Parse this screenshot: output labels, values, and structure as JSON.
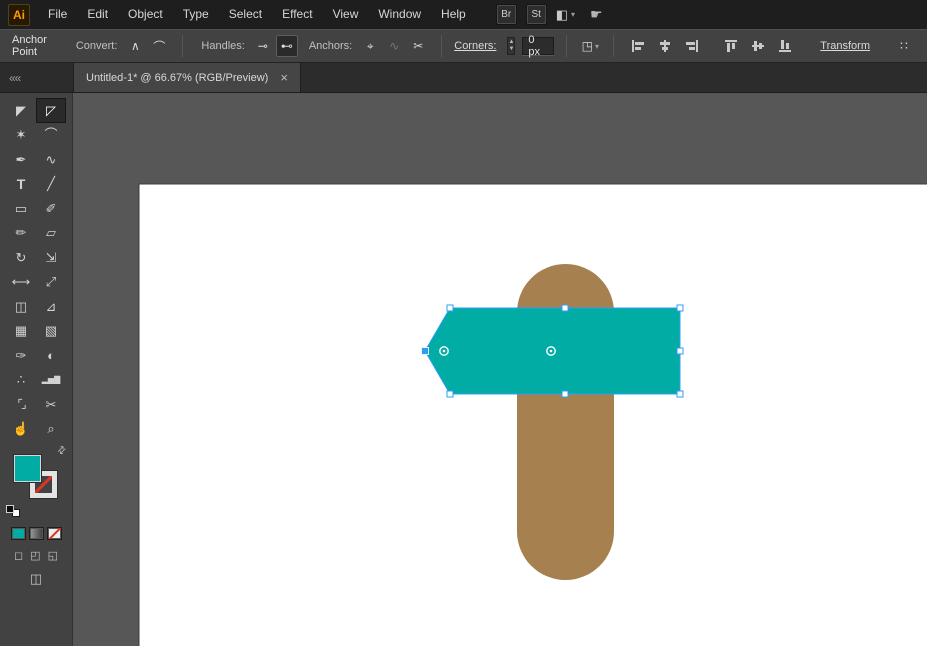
{
  "colors": {
    "accent_orange": "#ff9a00",
    "teal": "#00aca4",
    "brown": "#a6804e",
    "selection_blue": "#2f9cf5",
    "none_red": "#e0341f"
  },
  "menubar": {
    "logo": "Ai",
    "items": [
      "File",
      "Edit",
      "Object",
      "Type",
      "Select",
      "Effect",
      "View",
      "Window",
      "Help"
    ],
    "bridge_label": "Br",
    "stock_label": "St",
    "workspace_glyph": "◧",
    "caret_glyph": "▾",
    "touch_glyph": "☛"
  },
  "controlbar": {
    "title": "Anchor Point",
    "convert_label": "Convert:",
    "convert_buttons": [
      {
        "name": "convert-to-corner-button",
        "glyph": "∧",
        "state": "normal"
      },
      {
        "name": "convert-to-smooth-button",
        "glyph": "⌒",
        "state": "normal"
      }
    ],
    "handles_label": "Handles:",
    "handle_buttons": [
      {
        "name": "hide-handles-button",
        "glyph": "⊸",
        "state": "normal"
      },
      {
        "name": "show-handles-button",
        "glyph": "⊷",
        "state": "pressed"
      }
    ],
    "anchors_label": "Anchors:",
    "anchor_buttons": [
      {
        "name": "remove-anchor-button",
        "glyph": "⌖",
        "state": "normal"
      },
      {
        "name": "connect-anchors-button",
        "glyph": "∿",
        "state": "disabled"
      },
      {
        "name": "cut-path-button",
        "glyph": "✂",
        "state": "normal"
      }
    ],
    "corners_label": "Corners:",
    "corners_value": "0 px",
    "stepper_up": "▲",
    "stepper_down": "▼",
    "select_similar_glyph": "◳",
    "transform_label": "Transform",
    "panel_menu_glyph": "∷"
  },
  "tabbar": {
    "collapse_glyph": "««",
    "title": "Untitled-1* @ 66.67% (RGB/Preview)",
    "close_glyph": "×"
  },
  "toolbar": {
    "tools": [
      {
        "name": "selection-tool",
        "glyph": "◤",
        "selected": "false"
      },
      {
        "name": "direct-selection-tool",
        "glyph": "◸",
        "selected": "true"
      },
      {
        "name": "magic-wand-tool",
        "glyph": "✶",
        "selected": "false"
      },
      {
        "name": "lasso-tool",
        "glyph": "⌒",
        "selected": "false"
      },
      {
        "name": "pen-tool",
        "glyph": "✒",
        "selected": "false"
      },
      {
        "name": "curvature-tool",
        "glyph": "∿",
        "selected": "false"
      },
      {
        "name": "type-tool",
        "glyph": "T",
        "selected": "false"
      },
      {
        "name": "line-segment-tool",
        "glyph": "╱",
        "selected": "false"
      },
      {
        "name": "rectangle-tool",
        "glyph": "▭",
        "selected": "false"
      },
      {
        "name": "paintbrush-tool",
        "glyph": "✐",
        "selected": "false"
      },
      {
        "name": "pencil-tool",
        "glyph": "✏",
        "selected": "false"
      },
      {
        "name": "eraser-tool",
        "glyph": "▱",
        "selected": "false"
      },
      {
        "name": "rotate-tool",
        "glyph": "↻",
        "selected": "false"
      },
      {
        "name": "scale-tool",
        "glyph": "⇲",
        "selected": "false"
      },
      {
        "name": "width-tool",
        "glyph": "⟷",
        "selected": "false"
      },
      {
        "name": "free-transform-tool",
        "glyph": "⤢",
        "selected": "false"
      },
      {
        "name": "shape-builder-tool",
        "glyph": "◫",
        "selected": "false"
      },
      {
        "name": "perspective-grid-tool",
        "glyph": "⊿",
        "selected": "false"
      },
      {
        "name": "mesh-tool",
        "glyph": "▦",
        "selected": "false"
      },
      {
        "name": "gradient-tool",
        "glyph": "▧",
        "selected": "false"
      },
      {
        "name": "eyedropper-tool",
        "glyph": "✑",
        "selected": "false"
      },
      {
        "name": "blend-tool",
        "glyph": "◐",
        "selected": "false"
      },
      {
        "name": "symbol-sprayer-tool",
        "glyph": "∴",
        "selected": "false"
      },
      {
        "name": "column-graph-tool",
        "glyph": "▂▅▇",
        "selected": "false"
      },
      {
        "name": "artboard-tool",
        "glyph": "⌜⌟",
        "selected": "false"
      },
      {
        "name": "slice-tool",
        "glyph": "✂",
        "selected": "false"
      },
      {
        "name": "hand-tool",
        "glyph": "☝",
        "selected": "false"
      },
      {
        "name": "zoom-tool",
        "glyph": "⌕",
        "selected": "false"
      }
    ],
    "swap_glyph": "⇄",
    "draw_modes": [
      {
        "name": "draw-normal-mode",
        "glyph": "◻"
      },
      {
        "name": "draw-behind-mode",
        "glyph": "◰"
      },
      {
        "name": "draw-inside-mode",
        "glyph": "◱"
      }
    ],
    "screen_mode_glyph": "◫"
  }
}
